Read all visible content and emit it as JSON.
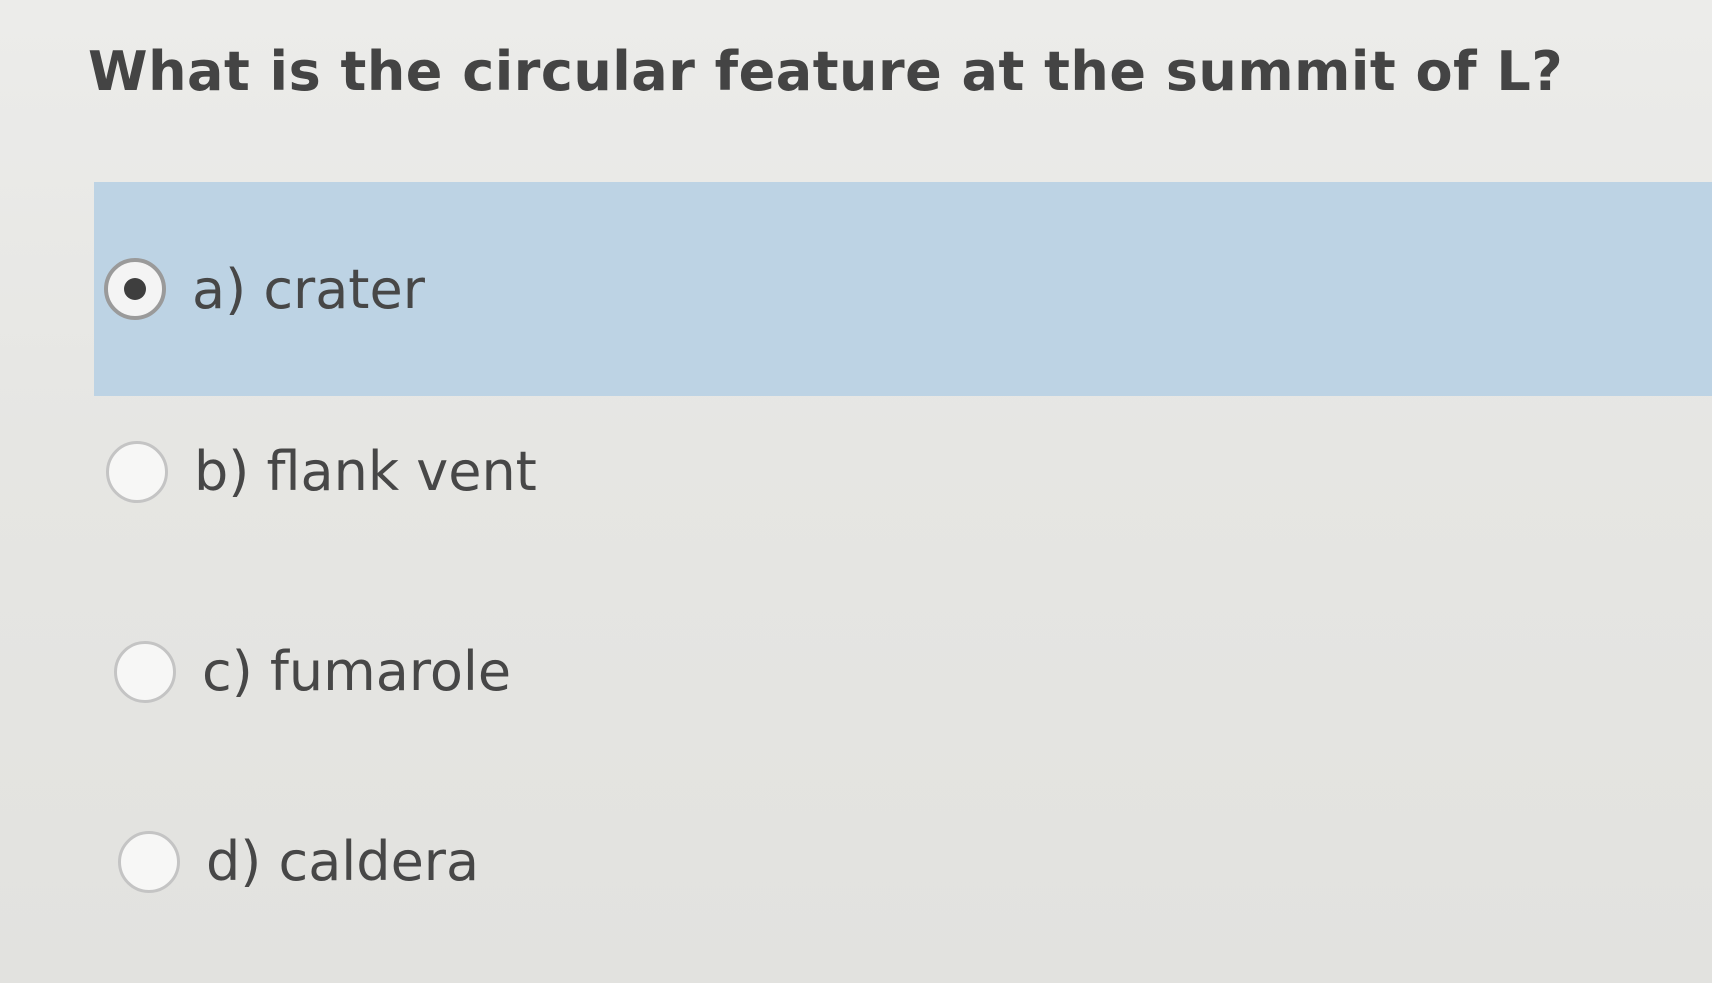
{
  "question": {
    "text": "What is the circular feature at the summit of L?"
  },
  "options": [
    {
      "label": "a) crater",
      "selected": true
    },
    {
      "label": "b) flank vent",
      "selected": false
    },
    {
      "label": "c) fumarole",
      "selected": false
    },
    {
      "label": "d) caldera",
      "selected": false
    }
  ],
  "colors": {
    "background": "#e6e6e3",
    "selected_highlight": "#bdd3e4",
    "text": "#444444"
  }
}
